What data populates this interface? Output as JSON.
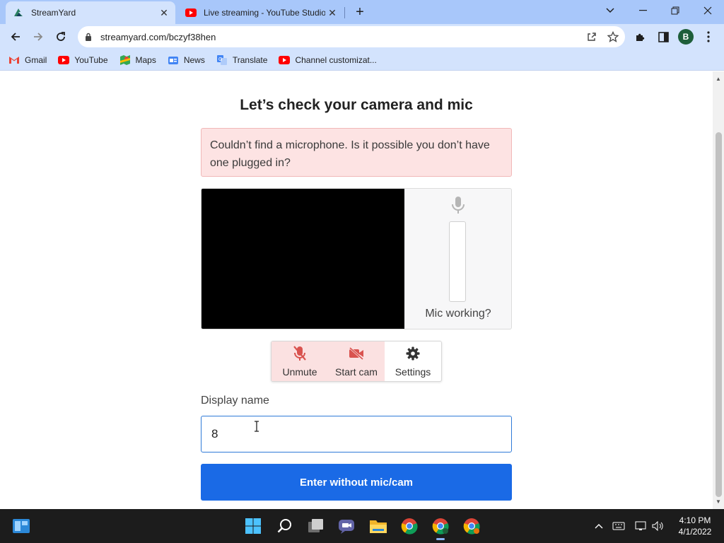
{
  "tabs": [
    {
      "title": "StreamYard",
      "active": true
    },
    {
      "title": "Live streaming - YouTube Studio",
      "active": false
    }
  ],
  "address_bar": {
    "url": "streamyard.com/bczyf38hen"
  },
  "profile": {
    "initial": "B"
  },
  "bookmarks": [
    {
      "label": "Gmail",
      "icon": "gmail-icon"
    },
    {
      "label": "YouTube",
      "icon": "youtube-icon"
    },
    {
      "label": "Maps",
      "icon": "maps-icon"
    },
    {
      "label": "News",
      "icon": "news-icon"
    },
    {
      "label": "Translate",
      "icon": "translate-icon"
    },
    {
      "label": "Channel customizat...",
      "icon": "youtube-icon"
    }
  ],
  "page": {
    "heading": "Let’s check your camera and mic",
    "alert": "Couldn’t find a microphone. Is it possible you don’t have one plugged in?",
    "mic_label": "Mic working?",
    "controls": [
      {
        "label": "Unmute",
        "icon": "mic-off-icon"
      },
      {
        "label": "Start cam",
        "icon": "camera-off-icon"
      },
      {
        "label": "Settings",
        "icon": "gear-icon"
      }
    ],
    "display_name_label": "Display name",
    "display_name_value": "8",
    "enter_button": "Enter without mic/cam"
  },
  "taskbar": {
    "time": "4:10 PM",
    "date": "4/1/2022"
  },
  "colors": {
    "tabstrip": "#a8c7fa",
    "toolbar": "#d3e3fd",
    "alert_bg": "#fde3e3",
    "control_active": "#fbe1e1",
    "control_icon_red": "#d9534f",
    "primary_button": "#1a6ae6",
    "taskbar": "#1c1c1c"
  }
}
